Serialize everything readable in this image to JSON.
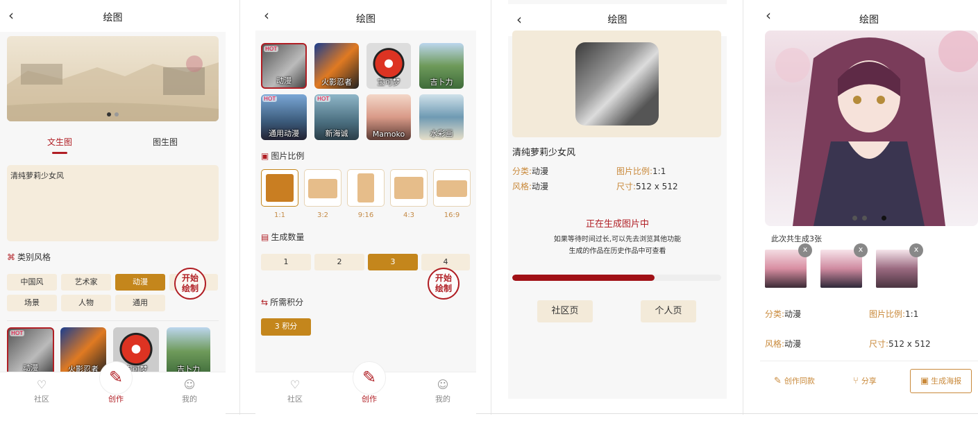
{
  "title": "绘图",
  "panel1": {
    "tabs": [
      "文生图",
      "图生图"
    ],
    "prompt": "清纯萝莉少女风",
    "style_section": "类别风格",
    "chips": [
      "中国风",
      "艺术家",
      "动漫",
      "场景",
      "人物",
      "通用"
    ],
    "selected_chip": "动漫",
    "seal": "开始绘制",
    "thumbs": [
      "动漫",
      "火影忍者",
      "宝可梦",
      "吉卜力"
    ],
    "hot": "HOT"
  },
  "panel2": {
    "styles": [
      "动漫",
      "火影忍者",
      "宝可梦",
      "吉卜力",
      "通用动漫",
      "新海诚",
      "Mamoko",
      "水彩画"
    ],
    "ratio_section": "图片比例",
    "ratios": [
      "1:1",
      "3:2",
      "9:16",
      "4:3",
      "16:9"
    ],
    "count_section": "生成数量",
    "counts": [
      "1",
      "2",
      "3",
      "4"
    ],
    "points_section": "所需积分",
    "points": "3 积分",
    "seal": "开始绘制"
  },
  "panel3": {
    "prompt": "清纯萝莉少女风",
    "labels": {
      "category": "分类:",
      "style": "风格:",
      "ratio": "图片比例:",
      "size": "尺寸:"
    },
    "values": {
      "category": "动漫",
      "style": "动漫",
      "ratio": "1:1",
      "size": "512 x 512"
    },
    "status": "正在生成图片中",
    "hint1": "如果等待时间过长,可以先去浏览其他功能",
    "hint2": "生成的作品在历史作品中可查看",
    "progress": 0.68,
    "btn_community": "社区页",
    "btn_profile": "个人页"
  },
  "panel4": {
    "generated": "此次共生成3张",
    "close": "x",
    "labels": {
      "category": "分类:",
      "style": "风格:",
      "ratio": "图片比例:",
      "size": "尺寸:"
    },
    "values": {
      "category": "动漫",
      "style": "动漫",
      "ratio": "1:1",
      "size": "512 x 512"
    },
    "actions": [
      "创作同款",
      "分享",
      "生成海报"
    ]
  },
  "tabbar": {
    "community": "社区",
    "create": "创作",
    "mine": "我的"
  },
  "colors": {
    "accent": "#b01e24",
    "gold": "#c4861c",
    "cream": "#f5ecdc"
  }
}
